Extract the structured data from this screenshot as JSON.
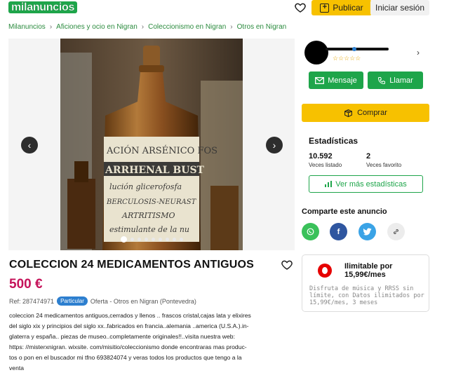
{
  "header": {
    "logo": "milanuncios",
    "publish_label": "Publicar",
    "login_label": "Iniciar sesión"
  },
  "breadcrumb": [
    "Milanuncios",
    "Aficiones y ocio en Nigran",
    "Coleccionismo en Nigran",
    "Otros en Nigran"
  ],
  "listing": {
    "title": "COLECCION 24 MEDICAMENTOS ANTIGUOS",
    "price": "500 €",
    "ref": "Ref: 287474971",
    "seller_type": "Particular",
    "offer_location": "Oferta - Otros en Nigran (Pontevedra)",
    "description": [
      "coleccion 24 medicamentos antiguos,cerrados y llenos .. frascos cristal,cajas lata y elixires",
      "del siglo xix y principios del siglo xx..fabricados en francia..alemania ..america (U.S.A.).in-",
      "glaterra y españa.. piezas de museo..completamente originales!!..visita nuestra web:",
      "https: //misterxnigran. wixsite. com/misitio/coleccionismo donde encontraras mas produc-",
      "tos o pon en el buscador mi tfno 693824074 y veras todos los productos que tengo a la",
      "venta"
    ],
    "photo_label_lines": [
      "ACIÓN ARSÉNICO FOS",
      "ARRHENAL BUST",
      "lución glicerofosfa",
      "BERCULOSIS-NEURAST",
      "ARTRITISMO",
      "estimulante de la nu"
    ]
  },
  "gallery": {
    "prev_icon": "chevron-left-icon",
    "next_icon": "chevron-right-icon",
    "slides": 9,
    "active_slide": 1
  },
  "seller": {
    "rating_stars": "☆☆☆☆☆",
    "message_label": "Mensaje",
    "call_label": "Llamar"
  },
  "buy_label": "Comprar",
  "stats": {
    "title": "Estadísticas",
    "views": "10.592",
    "views_label": "Veces listado",
    "favs": "2",
    "favs_label": "Veces favorito",
    "more_label": "Ver más estadísticas"
  },
  "share": {
    "title": "Comparte este anuncio",
    "buttons": [
      {
        "name": "whatsapp",
        "color": "#3ac15a"
      },
      {
        "name": "facebook",
        "color": "#2f56a0"
      },
      {
        "name": "twitter",
        "color": "#3aa3e6"
      },
      {
        "name": "link",
        "color": "#ececec"
      }
    ]
  },
  "promo": {
    "title": "Ilimitable por 15,99€/mes",
    "text": "Disfruta de música y RRSS sin límite, con Datos ilimitados por 15,99€/mes, 3 meses"
  },
  "colors": {
    "brand_green": "#1ea54a",
    "yellow": "#f7c100",
    "price": "#c5135a"
  }
}
